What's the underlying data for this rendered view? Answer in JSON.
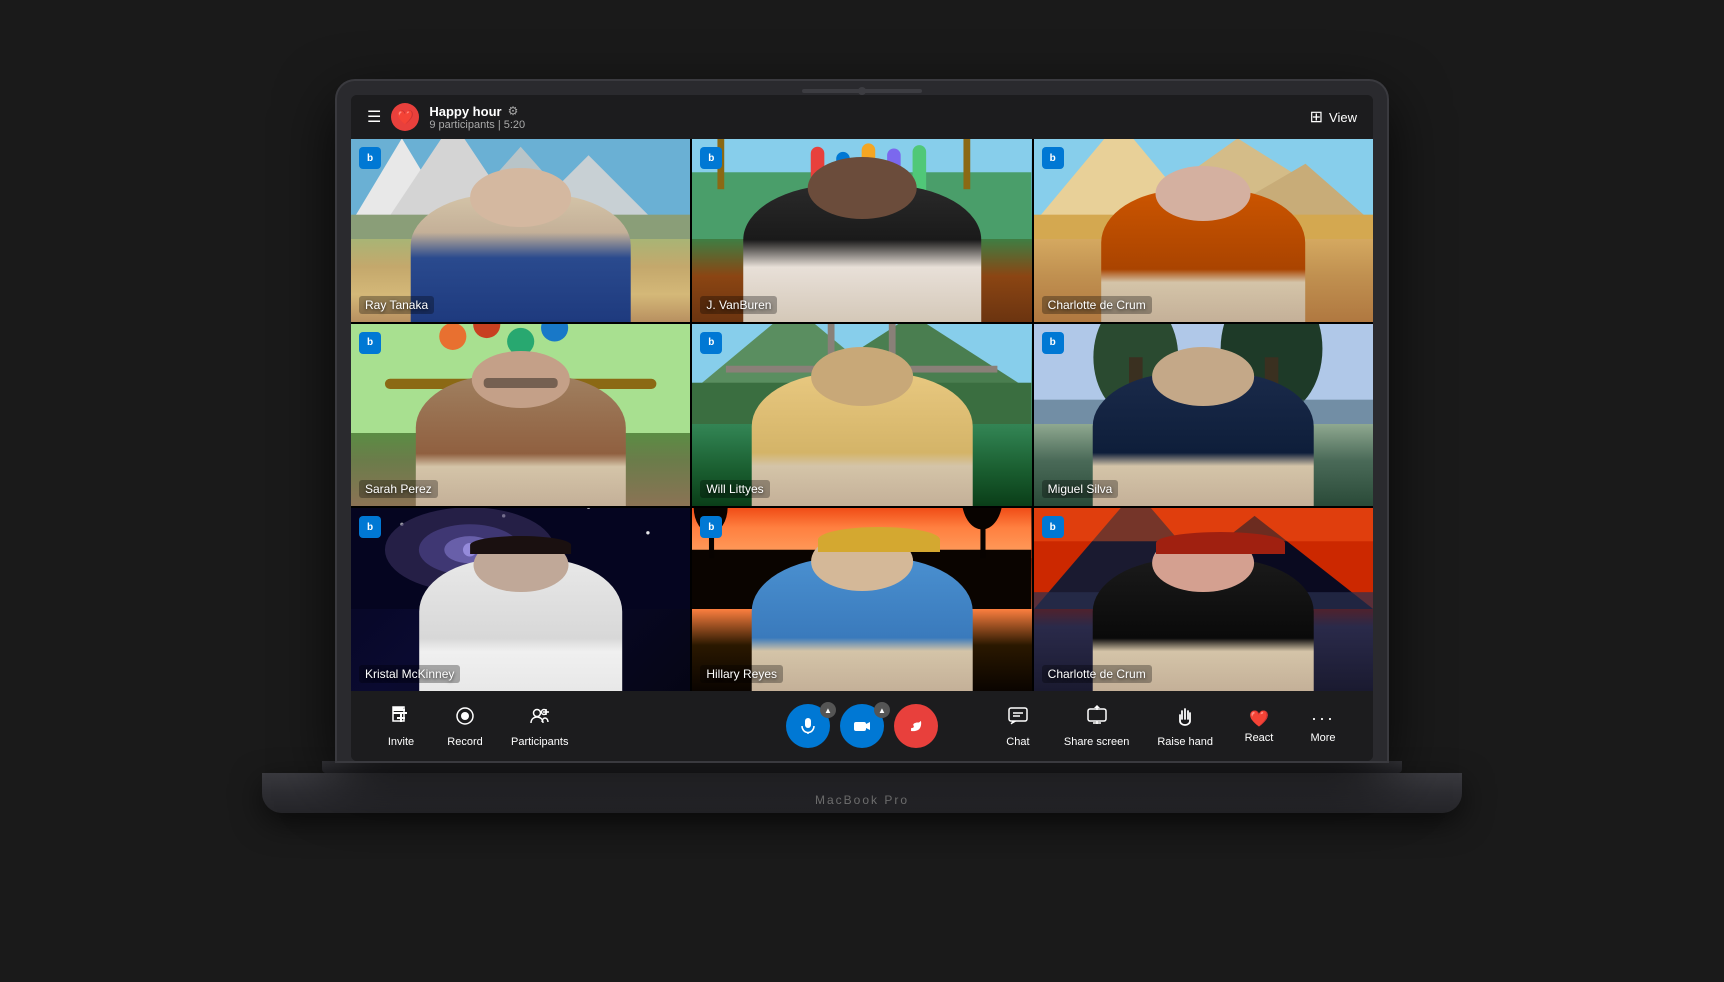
{
  "meeting": {
    "title": "Happy hour",
    "participants_count": "9 participants",
    "duration": "5:20",
    "meta": "9 participants | 5:20"
  },
  "header": {
    "view_label": "View",
    "hamburger": "☰",
    "emoji": "❤️",
    "gear": "⚙"
  },
  "participants": [
    {
      "name": "Ray Tanaka",
      "bg": "mountains",
      "id": 1
    },
    {
      "name": "J. VanBuren",
      "bg": "beach",
      "id": 2
    },
    {
      "name": "Charlotte de Crum",
      "bg": "desert",
      "id": 3
    },
    {
      "name": "Sarah Perez",
      "bg": "birds",
      "id": 4
    },
    {
      "name": "Will Littyes",
      "bg": "bridge",
      "id": 5
    },
    {
      "name": "Miguel Silva",
      "bg": "wetland",
      "id": 6
    },
    {
      "name": "Kristal McKinney",
      "bg": "galaxy",
      "id": 7
    },
    {
      "name": "Hillary Reyes",
      "bg": "sunset",
      "id": 8
    },
    {
      "name": "Charlotte de Crum",
      "bg": "mountain_lake",
      "id": 9
    }
  ],
  "toolbar": {
    "left_buttons": [
      {
        "id": "invite",
        "label": "Invite",
        "icon": "↑□"
      },
      {
        "id": "record",
        "label": "Record",
        "icon": "⊙"
      },
      {
        "id": "participants",
        "label": "Participants",
        "icon": "👥"
      }
    ],
    "center_buttons": [
      {
        "id": "mic",
        "label": "mic",
        "icon": "🎤",
        "color": "blue"
      },
      {
        "id": "camera",
        "label": "camera",
        "icon": "📷",
        "color": "blue"
      },
      {
        "id": "hangup",
        "label": "hangup",
        "icon": "📞",
        "color": "red"
      }
    ],
    "right_buttons": [
      {
        "id": "chat",
        "label": "Chat",
        "icon": "💬"
      },
      {
        "id": "share_screen",
        "label": "Share screen",
        "icon": "⬆"
      },
      {
        "id": "raise_hand",
        "label": "Raise hand",
        "icon": "✋"
      },
      {
        "id": "react",
        "label": "React",
        "icon": "❤️"
      },
      {
        "id": "more",
        "label": "More",
        "icon": "···"
      }
    ]
  },
  "laptop_label": "MacBook Pro",
  "colors": {
    "accent_blue": "#0078d4",
    "accent_red": "#e8403c",
    "bg_dark": "#1c1c1e",
    "text_white": "#ffffff"
  }
}
